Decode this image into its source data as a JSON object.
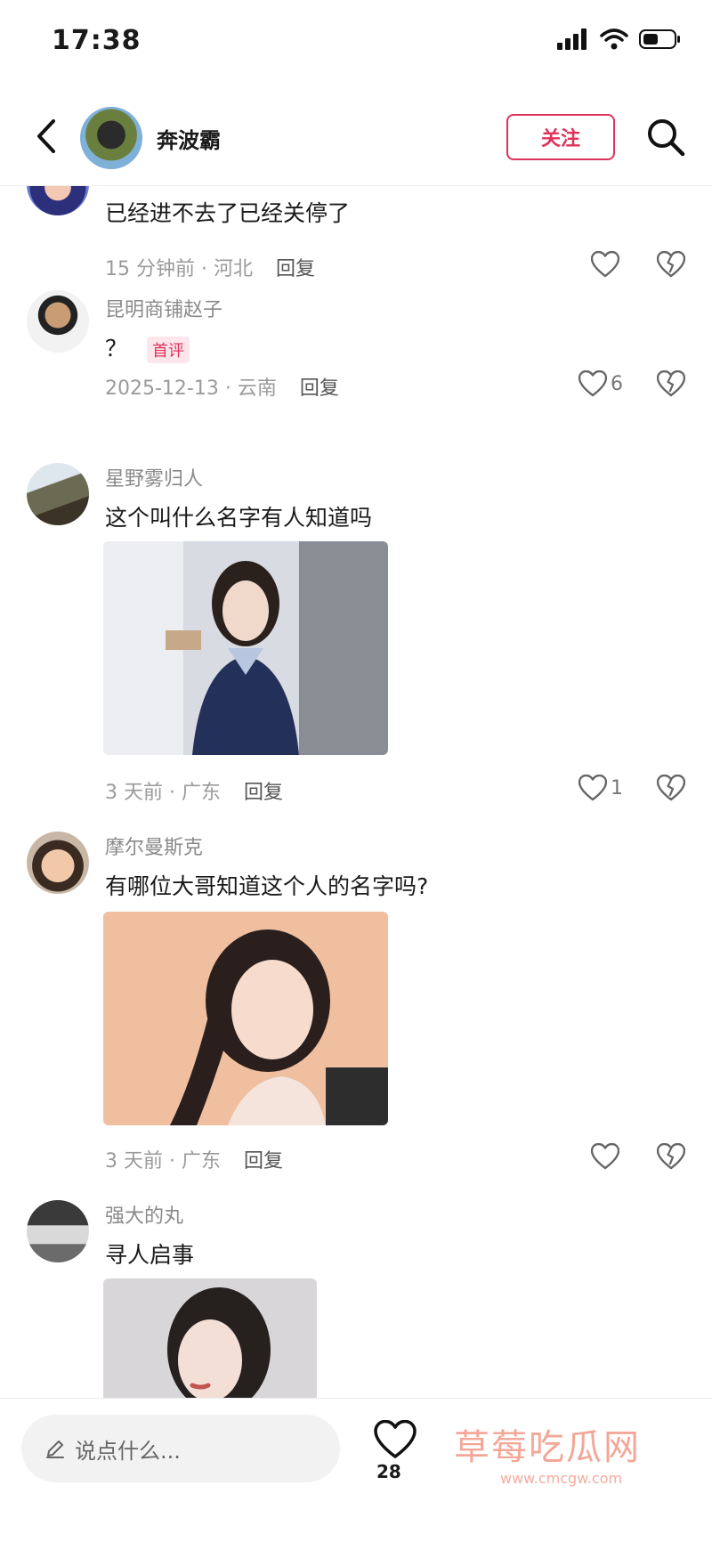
{
  "status_bar": {
    "time": "17:38"
  },
  "header": {
    "author": "奔波霸",
    "follow_label": "关注"
  },
  "comments": [
    {
      "user": "...",
      "text": "已经进不去了已经关停了",
      "meta": "15 分钟前 · 河北",
      "reply_label": "回复",
      "likes": ""
    },
    {
      "user": "昆明商铺赵子",
      "text": "？",
      "badge": "首评",
      "meta": "2025-12-13 · 云南",
      "reply_label": "回复",
      "likes": "6"
    },
    {
      "user": "星野雾归人",
      "text": "这个叫什么名字有人知道吗",
      "meta": "3 天前 · 广东",
      "reply_label": "回复",
      "likes": "1"
    },
    {
      "user": "摩尔曼斯克",
      "text": "有哪位大哥知道这个人的名字吗?",
      "meta": "3 天前 · 广东",
      "reply_label": "回复",
      "likes": ""
    },
    {
      "user": "强大的丸",
      "text": "寻人启事"
    }
  ],
  "bottom_bar": {
    "input_placeholder": "说点什么...",
    "like_count": "28",
    "watermark": "草莓吃瓜网",
    "watermark_url": "www.cmcgw.com"
  },
  "colors": {
    "accent": "#e0325a",
    "meta_gray": "#9a9a9a"
  },
  "icons": [
    "back-icon",
    "search-icon",
    "heart-icon",
    "broken-heart-icon",
    "pencil-icon",
    "signal-icon",
    "wifi-icon",
    "battery-icon"
  ]
}
